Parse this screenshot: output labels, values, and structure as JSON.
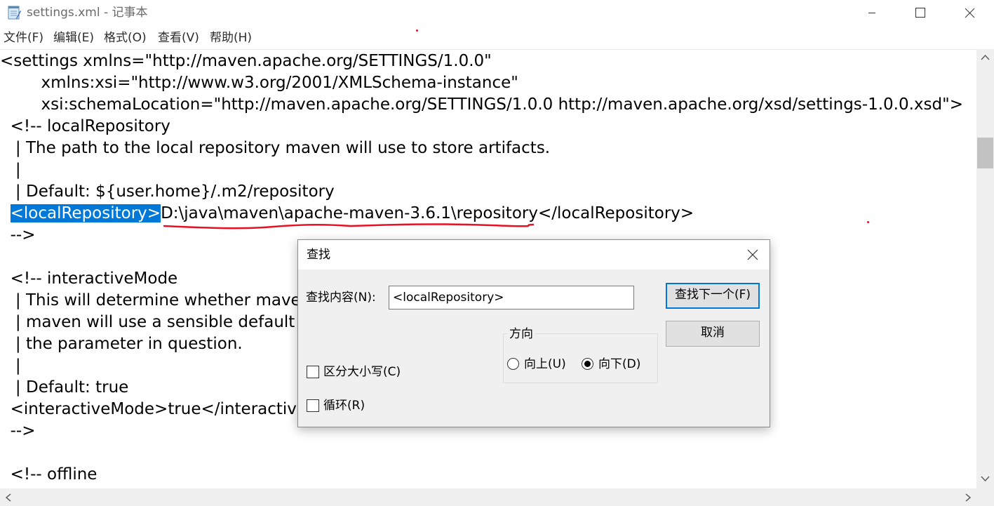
{
  "window": {
    "title": "settings.xml - 记事本",
    "controls": [
      "minimize",
      "maximize",
      "close"
    ]
  },
  "menu": [
    {
      "label": "文件(F)"
    },
    {
      "label": "编辑(E)"
    },
    {
      "label": "格式(O)"
    },
    {
      "label": "查看(V)"
    },
    {
      "label": "帮助(H)"
    }
  ],
  "editor": {
    "lines": [
      "<settings xmlns=\"http://maven.apache.org/SETTINGS/1.0.0\"",
      "        xmlns:xsi=\"http://www.w3.org/2001/XMLSchema-instance\"",
      "        xsi:schemaLocation=\"http://maven.apache.org/SETTINGS/1.0.0 http://maven.apache.org/xsd/settings-1.0.0.xsd\">",
      "  <!-- localRepository",
      "   | The path to the local repository maven will use to store artifacts.",
      "   |",
      "   | Default: ${user.home}/.m2/repository",
      "",
      "  -->",
      "",
      "  <!-- interactiveMode",
      "   | This will determine whether maven prompts you when it needs input. If set to false,",
      "   | maven will use a sensible default value, perhaps based on some other setting, for",
      "   | the parameter in question.",
      "   |",
      "   | Default: true",
      "  <interactiveMode>true</interactiveMode>",
      "  -->",
      "",
      "  <!-- offline"
    ],
    "selected_line": {
      "indent": "  ",
      "selected": "<localRepository>",
      "rest_path": "D:\\java\\maven\\apache-maven-3.6.1\\repository",
      "rest_close": "</localRepository>"
    },
    "highlight_color": "#0078d7",
    "annotation_color": "#e81123"
  },
  "find_dialog": {
    "title": "查找",
    "find_label": "查找内容(N):",
    "find_value": "<localRepository>",
    "find_next": "查找下一个(F)",
    "cancel": "取消",
    "direction_label": "方向",
    "up": "向上(U)",
    "down": "向下(D)",
    "direction_selected": "down",
    "match_case": "区分大小写(C)",
    "match_case_checked": false,
    "wrap": "循环(R)",
    "wrap_checked": false
  }
}
